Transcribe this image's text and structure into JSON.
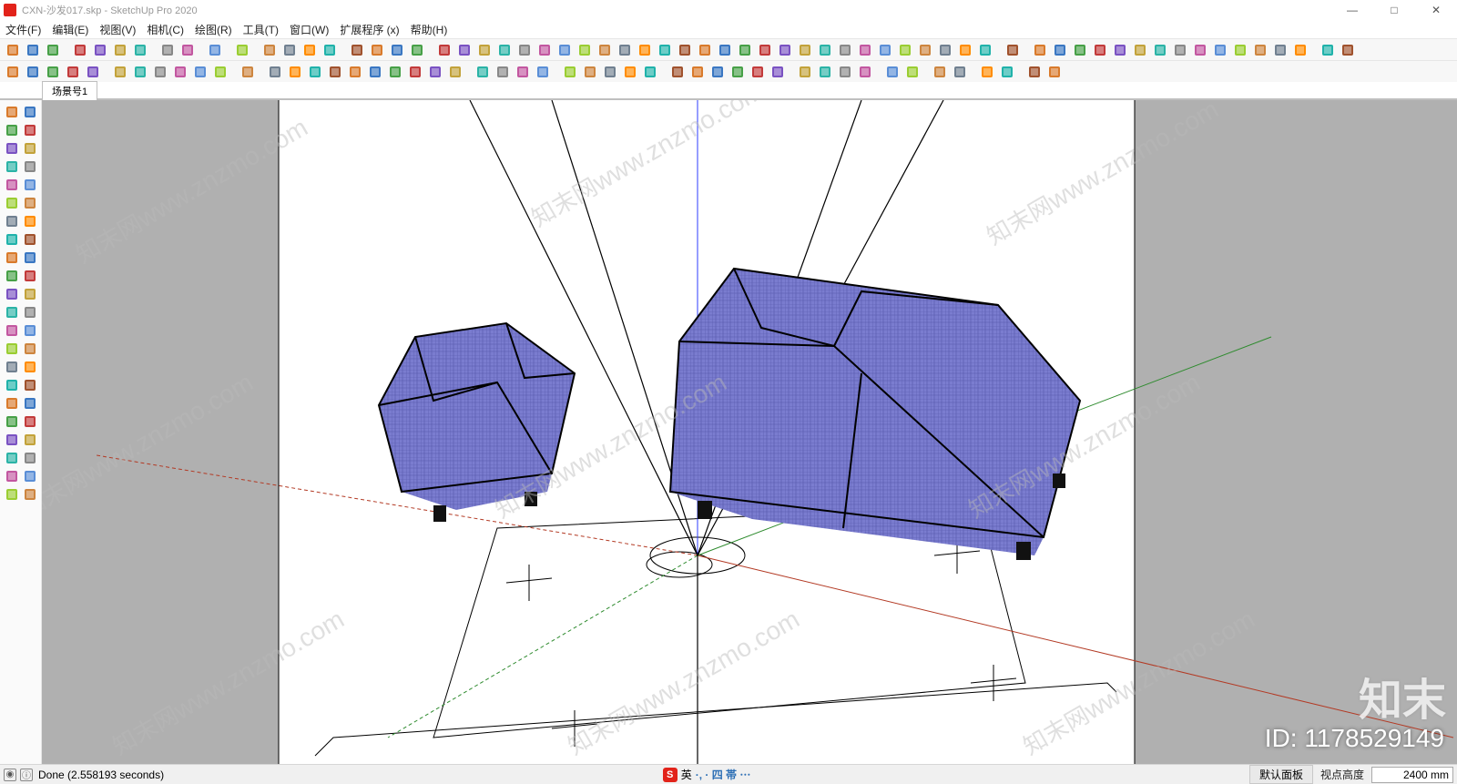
{
  "title": "CXN-沙发017.skp - SketchUp Pro 2020",
  "window_controls": {
    "min": "—",
    "max": "□",
    "close": "✕"
  },
  "menus": [
    "文件(F)",
    "编辑(E)",
    "视图(V)",
    "相机(C)",
    "绘图(R)",
    "工具(T)",
    "窗口(W)",
    "扩展程序 (x)",
    "帮助(H)"
  ],
  "toolbar_row1_names": [
    "file-new",
    "file-open",
    "file-save",
    "sep",
    "cut",
    "copy",
    "paste",
    "delete",
    "sep",
    "undo",
    "redo",
    "sep",
    "print",
    "sep",
    "model-info",
    "sep",
    "component",
    "group",
    "explode",
    "paint",
    "sep",
    "shadow",
    "fog",
    "xray",
    "back-edges",
    "sep",
    "select",
    "erase",
    "line",
    "freehand",
    "rectangle",
    "circle",
    "polygon",
    "arc",
    "pushpull",
    "followme",
    "offset",
    "move",
    "rotate",
    "scale",
    "tape",
    "protractor",
    "axes",
    "dimension",
    "text",
    "3dtext",
    "section",
    "orbit",
    "pan",
    "zoom",
    "zoom-extents",
    "walk",
    "lookaround",
    "position-camera",
    "sep",
    "extension-wh",
    "sep",
    "plugin-1",
    "plugin-2",
    "plugin-3",
    "plugin-4",
    "plugin-5",
    "plugin-6",
    "plugin-7",
    "plugin-8",
    "plugin-9",
    "plugin-10",
    "plugin-11",
    "plugin-12",
    "plugin-13",
    "plugin-14",
    "sep",
    "help",
    "user"
  ],
  "toolbar_row2_names": [
    "style-wire",
    "style-hidden",
    "style-shaded",
    "style-texture",
    "style-mono",
    "sep",
    "view-iso",
    "view-top",
    "view-front",
    "view-right",
    "view-back",
    "view-left",
    "sep",
    "layer-iso",
    "sep",
    "sandbox-1",
    "sandbox-2",
    "sandbox-3",
    "sandbox-4",
    "sandbox-5",
    "sandbox-6",
    "sandbox-7",
    "sandbox-8",
    "sandbox-9",
    "sandbox-10",
    "sep",
    "bezier-1",
    "bezier-2",
    "bezier-3",
    "bezier-4",
    "sep",
    "solid-union",
    "solid-subtract",
    "solid-intersect",
    "solid-trim",
    "solid-split",
    "sep",
    "curve-1",
    "curve-2",
    "curve-3",
    "curve-4",
    "curve-5",
    "curve-6",
    "sep",
    "plugin-a",
    "plugin-b",
    "plugin-c",
    "plugin-d",
    "sep",
    "mirror",
    "flip",
    "sep",
    "edge-soft",
    "edge-hard",
    "sep",
    "axes-tool",
    "weld",
    "sep",
    "scene-prev",
    "scene-next"
  ],
  "scene_tab": "场景号1",
  "left_tool_names": [
    [
      "select",
      "lasso"
    ],
    [
      "paint",
      "eraser"
    ],
    [
      "line",
      "freehand"
    ],
    [
      "rectangle",
      "circle"
    ],
    [
      "arc",
      "pie"
    ],
    [
      "polygon",
      "rotrect"
    ],
    [
      "pushpull",
      "followme"
    ],
    [
      "offset",
      "outershell"
    ],
    [
      "move",
      "rotate"
    ],
    [
      "scale",
      "tape"
    ],
    [
      "protractor",
      "axes"
    ],
    [
      "dimension",
      "text"
    ],
    [
      "3dtext",
      "section"
    ],
    [
      "orbit",
      "pan"
    ],
    [
      "zoom",
      "zoom-window"
    ],
    [
      "zoom-extents",
      "previous"
    ],
    [
      "position-camera",
      "walk"
    ],
    [
      "lookaround",
      "imagery"
    ],
    [
      "sandbox-a",
      "sandbox-b"
    ],
    [
      "solid-a",
      "solid-b"
    ],
    [
      "style-a",
      "style-b"
    ],
    [
      "plugin-x",
      "plugin-y"
    ]
  ],
  "status": {
    "done_text": "Done (2.558193 seconds)",
    "ime_label": "英",
    "ime_symbols": "·, · 四 帯 ⋯",
    "panel_button": "默认面板",
    "viewpoint_label": "视点高度",
    "viewpoint_value": "2400 mm"
  },
  "watermark": {
    "cn": "知末网",
    "url": "www.znzmo.com",
    "brand": "知末",
    "id_label": "ID: 1178529149"
  }
}
